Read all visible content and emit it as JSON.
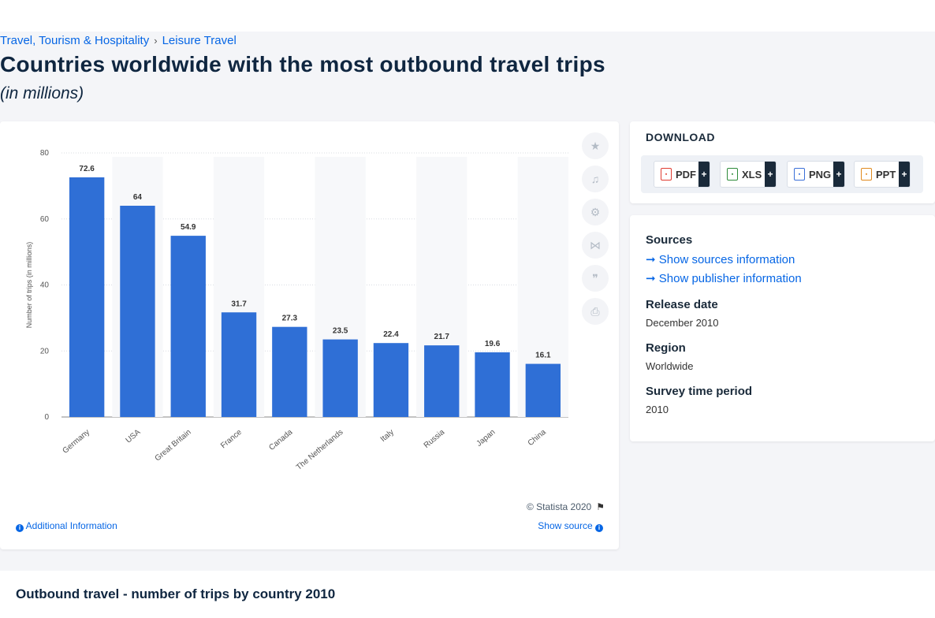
{
  "breadcrumb": {
    "item1": "Travel, Tourism & Hospitality",
    "item2": "Leisure Travel",
    "separator": "›"
  },
  "page": {
    "title": "Countries worldwide with the most outbound travel trips",
    "subtitle": "(in millions)"
  },
  "chart_footer": {
    "copyright": "© Statista 2020",
    "additional_info": "Additional Information",
    "show_source": "Show source"
  },
  "download": {
    "title": "DOWNLOAD",
    "buttons": [
      {
        "label": "PDF",
        "icon": "pdf-icon",
        "color": "#e03c31"
      },
      {
        "label": "XLS",
        "icon": "xls-icon",
        "color": "#2e8b3a"
      },
      {
        "label": "PNG",
        "icon": "png-icon",
        "color": "#3a6fd8"
      },
      {
        "label": "PPT",
        "icon": "ppt-icon",
        "color": "#e08a1e"
      }
    ],
    "plus": "+"
  },
  "info": {
    "sources_label": "Sources",
    "show_sources": "Show sources information",
    "show_publisher": "Show publisher information",
    "release_label": "Release date",
    "release_value": "December 2010",
    "region_label": "Region",
    "region_value": "Worldwide",
    "period_label": "Survey time period",
    "period_value": "2010"
  },
  "bottom": {
    "title": "Outbound travel - number of trips by country 2010"
  },
  "colors": {
    "bar": "#2f6fd6",
    "link": "#0666e5",
    "title": "#0f2640"
  },
  "chart_data": {
    "type": "bar",
    "categories": [
      "Germany",
      "USA",
      "Great Britain",
      "France",
      "Canada",
      "The Netherlands",
      "Italy",
      "Russia",
      "Japan",
      "China"
    ],
    "values": [
      72.6,
      64,
      54.9,
      31.7,
      27.3,
      23.5,
      22.4,
      21.7,
      19.6,
      16.1
    ],
    "value_labels": [
      "72.6",
      "64",
      "54.9",
      "31.7",
      "27.3",
      "23.5",
      "22.4",
      "21.7",
      "19.6",
      "16.1"
    ],
    "ylabel": "Number of trips (in millions)",
    "ylim": [
      0,
      80
    ],
    "yticks": [
      "0",
      "20",
      "40",
      "60",
      "80"
    ],
    "grid": true
  }
}
